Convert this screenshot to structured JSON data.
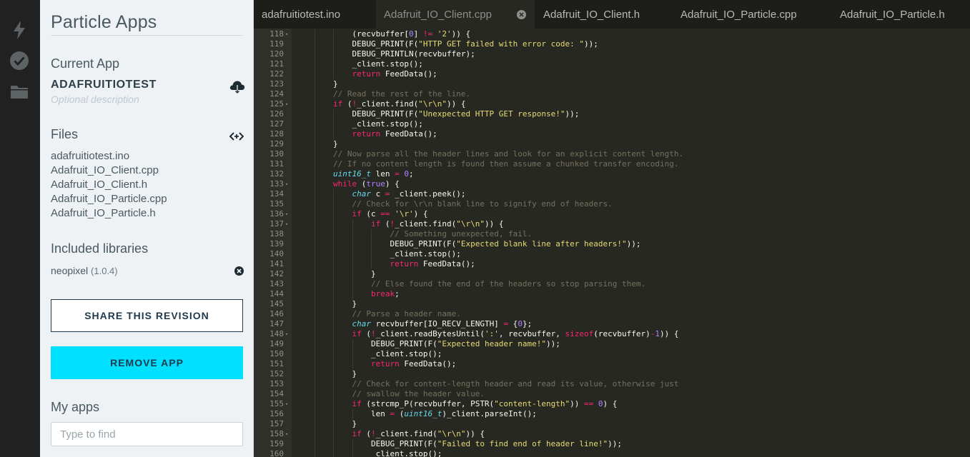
{
  "sidebar": {
    "title": "Particle Apps",
    "current_app_heading": "Current App",
    "app_name": "ADAFRUITIOTEST",
    "app_description_placeholder": "Optional description",
    "files_heading": "Files",
    "files": [
      "adafruitiotest.ino",
      "Adafruit_IO_Client.cpp",
      "Adafruit_IO_Client.h",
      "Adafruit_IO_Particle.cpp",
      "Adafruit_IO_Particle.h"
    ],
    "libraries_heading": "Included libraries",
    "library": {
      "name": "neopixel",
      "version": "(1.0.4)"
    },
    "share_label": "SHARE THIS REVISION",
    "remove_label": "REMOVE APP",
    "my_apps_heading": "My apps",
    "search_placeholder": "Type to find"
  },
  "rail_icons": [
    "flash-icon",
    "verify-icon",
    "folder-icon"
  ],
  "tabs": [
    {
      "label": "adafruitiotest.ino",
      "active": false
    },
    {
      "label": "Adafruit_IO_Client.cpp",
      "active": true
    },
    {
      "label": "Adafruit_IO_Client.h",
      "active": false
    },
    {
      "label": "Adafruit_IO_Particle.cpp",
      "active": false
    },
    {
      "label": "Adafruit_IO_Particle.h",
      "active": false
    }
  ],
  "colors": {
    "accent": "#00e1ff",
    "editor_bg": "#272822",
    "keyword": "#f92672",
    "string": "#e6db74",
    "number": "#ae81ff",
    "comment": "#75715e",
    "type": "#66d9ef"
  },
  "code_lines": [
    {
      "n": 118,
      "fold": true,
      "indent": 3,
      "t": [
        [
          "",
          "(recvbuffer["
        ],
        [
          "num",
          "0"
        ],
        [
          "",
          "] "
        ],
        [
          "kw",
          "!="
        ],
        [
          "",
          " "
        ],
        [
          "str",
          "'2'"
        ],
        [
          "",
          ")) {"
        ]
      ]
    },
    {
      "n": 119,
      "indent": 3,
      "t": [
        [
          "",
          "DEBUG_PRINT(F("
        ],
        [
          "str",
          "\"HTTP GET failed with error code: \""
        ],
        [
          "",
          "));"
        ]
      ]
    },
    {
      "n": 120,
      "indent": 3,
      "t": [
        [
          "",
          "DEBUG_PRINTLN(recvbuffer);"
        ]
      ]
    },
    {
      "n": 121,
      "indent": 3,
      "t": [
        [
          "",
          "_client.stop();"
        ]
      ]
    },
    {
      "n": 122,
      "indent": 3,
      "t": [
        [
          "kw",
          "return"
        ],
        [
          "",
          " FeedData();"
        ]
      ]
    },
    {
      "n": 123,
      "indent": 2,
      "t": [
        [
          "",
          "}"
        ]
      ]
    },
    {
      "n": 124,
      "indent": 2,
      "t": [
        [
          "cm",
          "// Read the rest of the line."
        ]
      ]
    },
    {
      "n": 125,
      "fold": true,
      "indent": 2,
      "t": [
        [
          "kw",
          "if"
        ],
        [
          "",
          " ("
        ],
        [
          "kw",
          "!"
        ],
        [
          "",
          "_client.find("
        ],
        [
          "str",
          "\"\\r\\n\""
        ],
        [
          "",
          ")) {"
        ]
      ]
    },
    {
      "n": 126,
      "indent": 3,
      "t": [
        [
          "",
          "DEBUG_PRINT(F("
        ],
        [
          "str",
          "\"Unexpected HTTP GET response!\""
        ],
        [
          "",
          "));"
        ]
      ]
    },
    {
      "n": 127,
      "indent": 3,
      "t": [
        [
          "",
          "_client.stop();"
        ]
      ]
    },
    {
      "n": 128,
      "indent": 3,
      "t": [
        [
          "kw",
          "return"
        ],
        [
          "",
          " FeedData();"
        ]
      ]
    },
    {
      "n": 129,
      "indent": 2,
      "t": [
        [
          "",
          "}"
        ]
      ]
    },
    {
      "n": 130,
      "indent": 2,
      "t": [
        [
          "cm",
          "// Now parse all the header lines and look for an explicit content length."
        ]
      ]
    },
    {
      "n": 131,
      "indent": 2,
      "t": [
        [
          "cm",
          "// If no content length is found then assume a chunked transfer encoding."
        ]
      ]
    },
    {
      "n": 132,
      "indent": 2,
      "t": [
        [
          "ty",
          "uint16_t"
        ],
        [
          "",
          " len "
        ],
        [
          "kw",
          "="
        ],
        [
          "",
          " "
        ],
        [
          "num",
          "0"
        ],
        [
          "",
          ";"
        ]
      ]
    },
    {
      "n": 133,
      "fold": true,
      "indent": 2,
      "t": [
        [
          "kw",
          "while"
        ],
        [
          "",
          " ("
        ],
        [
          "num",
          "true"
        ],
        [
          "",
          ") {"
        ]
      ]
    },
    {
      "n": 134,
      "indent": 3,
      "t": [
        [
          "ty",
          "char"
        ],
        [
          "",
          " c "
        ],
        [
          "kw",
          "="
        ],
        [
          "",
          " _client.peek();"
        ]
      ]
    },
    {
      "n": 135,
      "indent": 3,
      "t": [
        [
          "cm",
          "// Check for \\r\\n blank line to signify end of headers."
        ]
      ]
    },
    {
      "n": 136,
      "fold": true,
      "indent": 3,
      "t": [
        [
          "kw",
          "if"
        ],
        [
          "",
          " (c "
        ],
        [
          "kw",
          "=="
        ],
        [
          "",
          " "
        ],
        [
          "str",
          "'\\r'"
        ],
        [
          "",
          ") {"
        ]
      ]
    },
    {
      "n": 137,
      "fold": true,
      "indent": 4,
      "t": [
        [
          "kw",
          "if"
        ],
        [
          "",
          " ("
        ],
        [
          "kw",
          "!"
        ],
        [
          "",
          "_client.find("
        ],
        [
          "str",
          "\"\\r\\n\""
        ],
        [
          "",
          ")) {"
        ]
      ]
    },
    {
      "n": 138,
      "indent": 5,
      "t": [
        [
          "cm",
          "// Something unexpected, fail."
        ]
      ]
    },
    {
      "n": 139,
      "indent": 5,
      "t": [
        [
          "",
          "DEBUG_PRINT(F("
        ],
        [
          "str",
          "\"Expected blank line after headers!\""
        ],
        [
          "",
          "));"
        ]
      ]
    },
    {
      "n": 140,
      "indent": 5,
      "t": [
        [
          "",
          "_client.stop();"
        ]
      ]
    },
    {
      "n": 141,
      "indent": 5,
      "t": [
        [
          "kw",
          "return"
        ],
        [
          "",
          " FeedData();"
        ]
      ]
    },
    {
      "n": 142,
      "indent": 4,
      "t": [
        [
          "",
          "}"
        ]
      ]
    },
    {
      "n": 143,
      "indent": 4,
      "t": [
        [
          "cm",
          "// Else found the end of the headers so stop parsing them."
        ]
      ]
    },
    {
      "n": 144,
      "indent": 4,
      "t": [
        [
          "kw",
          "break"
        ],
        [
          "",
          ";"
        ]
      ]
    },
    {
      "n": 145,
      "indent": 3,
      "t": [
        [
          "",
          "}"
        ]
      ]
    },
    {
      "n": 146,
      "indent": 3,
      "t": [
        [
          "cm",
          "// Parse a header name."
        ]
      ]
    },
    {
      "n": 147,
      "indent": 3,
      "t": [
        [
          "ty",
          "char"
        ],
        [
          "",
          " recvbuffer[IO_RECV_LENGTH] "
        ],
        [
          "kw",
          "="
        ],
        [
          "",
          " {"
        ],
        [
          "num",
          "0"
        ],
        [
          "",
          "};"
        ]
      ]
    },
    {
      "n": 148,
      "fold": true,
      "indent": 3,
      "t": [
        [
          "kw",
          "if"
        ],
        [
          "",
          " ("
        ],
        [
          "kw",
          "!"
        ],
        [
          "",
          "_client.readBytesUntil("
        ],
        [
          "str",
          "':'"
        ],
        [
          "",
          ", recvbuffer, "
        ],
        [
          "kw",
          "sizeof"
        ],
        [
          "",
          "(recvbuffer)"
        ],
        [
          "kw",
          "-"
        ],
        [
          "num",
          "1"
        ],
        [
          "",
          ")) {"
        ]
      ]
    },
    {
      "n": 149,
      "indent": 4,
      "t": [
        [
          "",
          "DEBUG_PRINT(F("
        ],
        [
          "str",
          "\"Expected header name!\""
        ],
        [
          "",
          "));"
        ]
      ]
    },
    {
      "n": 150,
      "indent": 4,
      "t": [
        [
          "",
          "_client.stop();"
        ]
      ]
    },
    {
      "n": 151,
      "indent": 4,
      "t": [
        [
          "kw",
          "return"
        ],
        [
          "",
          " FeedData();"
        ]
      ]
    },
    {
      "n": 152,
      "indent": 3,
      "t": [
        [
          "",
          "}"
        ]
      ]
    },
    {
      "n": 153,
      "indent": 3,
      "t": [
        [
          "cm",
          "// Check for content-length header and read its value, otherwise just"
        ]
      ]
    },
    {
      "n": 154,
      "indent": 3,
      "t": [
        [
          "cm",
          "// swallow the header value."
        ]
      ]
    },
    {
      "n": 155,
      "fold": true,
      "indent": 3,
      "t": [
        [
          "kw",
          "if"
        ],
        [
          "",
          " (strcmp_P(recvbuffer, PSTR("
        ],
        [
          "str",
          "\"content-length\""
        ],
        [
          "",
          ")) "
        ],
        [
          "kw",
          "=="
        ],
        [
          "",
          " "
        ],
        [
          "num",
          "0"
        ],
        [
          "",
          ") {"
        ]
      ]
    },
    {
      "n": 156,
      "indent": 4,
      "t": [
        [
          "",
          "len "
        ],
        [
          "kw",
          "="
        ],
        [
          "",
          " ("
        ],
        [
          "ty",
          "uint16_t"
        ],
        [
          "",
          ")_client.parseInt();"
        ]
      ]
    },
    {
      "n": 157,
      "indent": 3,
      "t": [
        [
          "",
          "}"
        ]
      ]
    },
    {
      "n": 158,
      "fold": true,
      "indent": 3,
      "t": [
        [
          "kw",
          "if"
        ],
        [
          "",
          " ("
        ],
        [
          "kw",
          "!"
        ],
        [
          "",
          "_client.find("
        ],
        [
          "str",
          "\"\\r\\n\""
        ],
        [
          "",
          ")) {"
        ]
      ]
    },
    {
      "n": 159,
      "indent": 4,
      "t": [
        [
          "",
          "DEBUG_PRINT(F("
        ],
        [
          "str",
          "\"Failed to find end of header line!\""
        ],
        [
          "",
          "));"
        ]
      ]
    },
    {
      "n": 160,
      "indent": 4,
      "t": [
        [
          "",
          "_client.stop();"
        ]
      ]
    }
  ]
}
